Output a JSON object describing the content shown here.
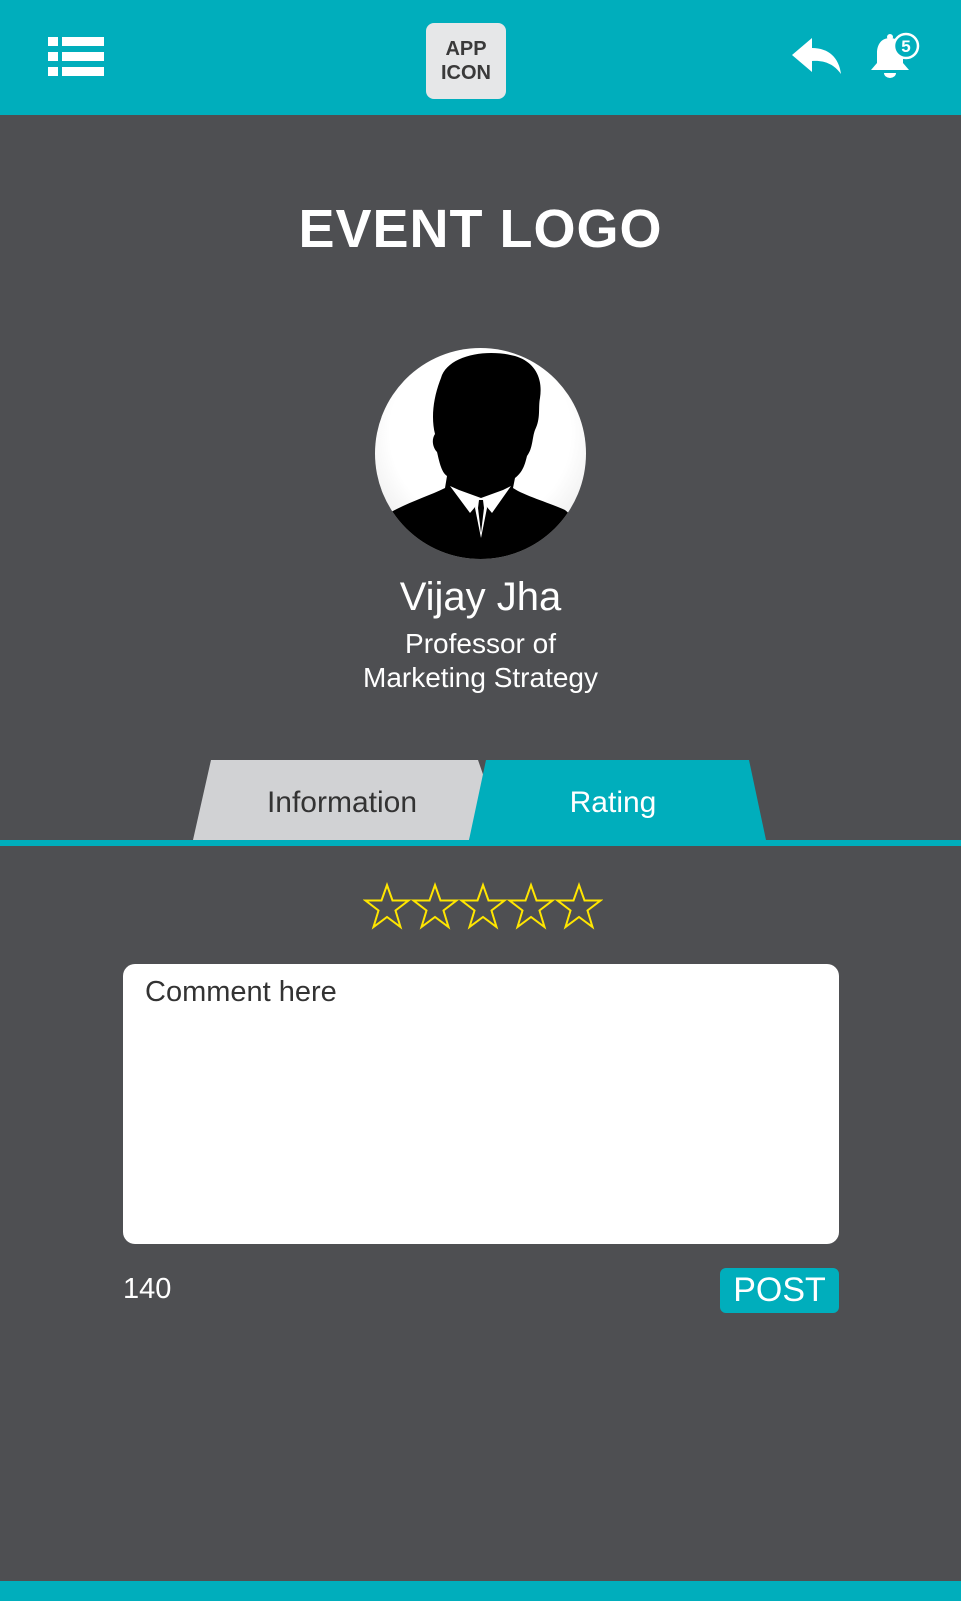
{
  "header": {
    "app_icon_line1": "APP",
    "app_icon_line2": "ICON",
    "notification_count": "5",
    "bg_color": "#00aebc"
  },
  "event": {
    "logo_text": "EVENT LOGO"
  },
  "speaker": {
    "name": "Vijay Jha",
    "title_line1": "Professor of",
    "title_line2": "Marketing Strategy"
  },
  "tabs": [
    {
      "label": "Information",
      "active": false
    },
    {
      "label": "Rating",
      "active": true
    }
  ],
  "rating": {
    "max": 5,
    "value": 0,
    "star_color": "#ffe600"
  },
  "comment": {
    "placeholder": "Comment here",
    "value": "",
    "char_count": "140"
  },
  "actions": {
    "post_label": "POST"
  },
  "icons": [
    "menu-list-icon",
    "reply-icon",
    "bell-icon",
    "star-icon"
  ],
  "colors": {
    "accent": "#00aebc",
    "background": "#4e4f52",
    "tab_inactive": "#d1d2d4"
  }
}
